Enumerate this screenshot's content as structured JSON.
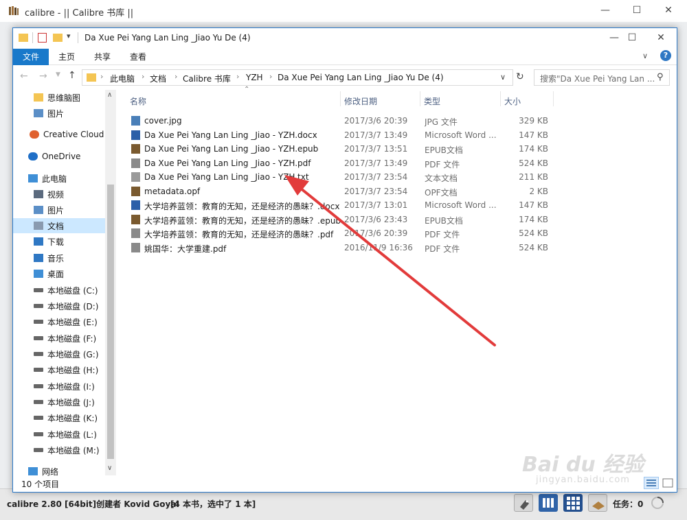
{
  "calibre": {
    "title": "calibre - || Calibre 书库 ||",
    "status_left": "calibre 2.80 [64bit]创建者 Kovid Goyal",
    "status_mid": "[4 本书，选中了 1 本]",
    "jobs_label": "任务：",
    "jobs_count": "0"
  },
  "explorer": {
    "title": "Da Xue Pei Yang Lan Ling _Jiao Yu De (4)",
    "ribbon_tabs": [
      "文件",
      "主页",
      "共享",
      "查看"
    ],
    "breadcrumb": [
      "此电脑",
      "文档",
      "Calibre 书库",
      "YZH",
      "Da Xue Pei Yang Lan Ling _Jiao Yu De (4)"
    ],
    "search_placeholder": "搜索\"Da Xue Pei Yang Lan ...",
    "columns": {
      "name": "名称",
      "date": "修改日期",
      "type": "类型",
      "size": "大小"
    },
    "item_count": "10 个项目"
  },
  "nav_items": [
    {
      "label": "思维脑图",
      "icon": "folder-icon",
      "color": "#f4c553"
    },
    {
      "label": "图片",
      "icon": "pictures-icon",
      "color": "#5b8fc7"
    },
    {
      "label": "Creative Cloud F",
      "icon": "creative-cloud-icon",
      "color": "#e0612f"
    },
    {
      "label": "OneDrive",
      "icon": "onedrive-icon",
      "color": "#1f6fc7"
    },
    {
      "label": "此电脑",
      "icon": "computer-icon",
      "color": "#3f8fd6"
    },
    {
      "label": "视频",
      "icon": "videos-icon",
      "color": "#5b6a7e"
    },
    {
      "label": "图片",
      "icon": "pictures-icon",
      "color": "#5b8fc7"
    },
    {
      "label": "文档",
      "icon": "documents-icon",
      "color": "#8a9bb0"
    },
    {
      "label": "下载",
      "icon": "downloads-icon",
      "color": "#2f78c4"
    },
    {
      "label": "音乐",
      "icon": "music-icon",
      "color": "#2f78c4"
    },
    {
      "label": "桌面",
      "icon": "desktop-icon",
      "color": "#3f8fd6"
    },
    {
      "label": "本地磁盘 (C:)",
      "icon": "drive-icon",
      "color": "#666"
    },
    {
      "label": "本地磁盘 (D:)",
      "icon": "drive-icon",
      "color": "#666"
    },
    {
      "label": "本地磁盘 (E:)",
      "icon": "drive-icon",
      "color": "#666"
    },
    {
      "label": "本地磁盘 (F:)",
      "icon": "drive-icon",
      "color": "#666"
    },
    {
      "label": "本地磁盘 (G:)",
      "icon": "drive-icon",
      "color": "#666"
    },
    {
      "label": "本地磁盘 (H:)",
      "icon": "drive-icon",
      "color": "#666"
    },
    {
      "label": "本地磁盘 (I:)",
      "icon": "drive-icon",
      "color": "#666"
    },
    {
      "label": "本地磁盘 (J:)",
      "icon": "drive-icon",
      "color": "#666"
    },
    {
      "label": "本地磁盘 (K:)",
      "icon": "drive-icon",
      "color": "#666"
    },
    {
      "label": "本地磁盘 (L:)",
      "icon": "drive-icon",
      "color": "#666"
    },
    {
      "label": "本地磁盘 (M:)",
      "icon": "drive-icon",
      "color": "#666"
    },
    {
      "label": "网络",
      "icon": "network-icon",
      "color": "#3f8fd6"
    }
  ],
  "files": [
    {
      "name": "cover.jpg",
      "date": "2017/3/6 20:39",
      "type": "JPG 文件",
      "size": "329 KB",
      "icon": "image-file-icon",
      "color": "#4a7fb8"
    },
    {
      "name": "Da Xue Pei Yang Lan Ling _Jiao - YZH.docx",
      "date": "2017/3/7 13:49",
      "type": "Microsoft Word ...",
      "size": "147 KB",
      "icon": "word-file-icon",
      "color": "#2b5fa8"
    },
    {
      "name": "Da Xue Pei Yang Lan Ling _Jiao - YZH.epub",
      "date": "2017/3/7 13:51",
      "type": "EPUB文档",
      "size": "174 KB",
      "icon": "calibre-file-icon",
      "color": "#7a5a2f"
    },
    {
      "name": "Da Xue Pei Yang Lan Ling _Jiao - YZH.pdf",
      "date": "2017/3/7 13:49",
      "type": "PDF 文件",
      "size": "524 KB",
      "icon": "pdf-file-icon",
      "color": "#8a8a8a"
    },
    {
      "name": "Da Xue Pei Yang Lan Ling _Jiao - YZH.txt",
      "date": "2017/3/7 23:54",
      "type": "文本文档",
      "size": "211 KB",
      "icon": "text-file-icon",
      "color": "#9a9a9a"
    },
    {
      "name": "metadata.opf",
      "date": "2017/3/7 23:54",
      "type": "OPF文档",
      "size": "2 KB",
      "icon": "calibre-file-icon",
      "color": "#7a5a2f"
    },
    {
      "name": "大学培养蓝领：教育的无知，还是经济的愚昧？.docx",
      "date": "2017/3/7 13:01",
      "type": "Microsoft Word ...",
      "size": "147 KB",
      "icon": "word-file-icon",
      "color": "#2b5fa8"
    },
    {
      "name": "大学培养蓝领：教育的无知，还是经济的愚昧？.epub",
      "date": "2017/3/6 23:43",
      "type": "EPUB文档",
      "size": "174 KB",
      "icon": "calibre-file-icon",
      "color": "#7a5a2f"
    },
    {
      "name": "大学培养蓝领：教育的无知，还是经济的愚昧？.pdf",
      "date": "2017/3/6 20:39",
      "type": "PDF 文件",
      "size": "524 KB",
      "icon": "pdf-file-icon",
      "color": "#8a8a8a"
    },
    {
      "name": "姚国华：大学重建.pdf",
      "date": "2016/11/9 16:36",
      "type": "PDF 文件",
      "size": "524 KB",
      "icon": "pdf-file-icon",
      "color": "#8a8a8a"
    }
  ],
  "watermark": {
    "text": "Bai du 经验",
    "sub": "jingyan.baidu.com"
  },
  "colors": {
    "accent": "#1979ca",
    "selected_nav": "#cce8ff",
    "arrow": "#e23b3b"
  }
}
